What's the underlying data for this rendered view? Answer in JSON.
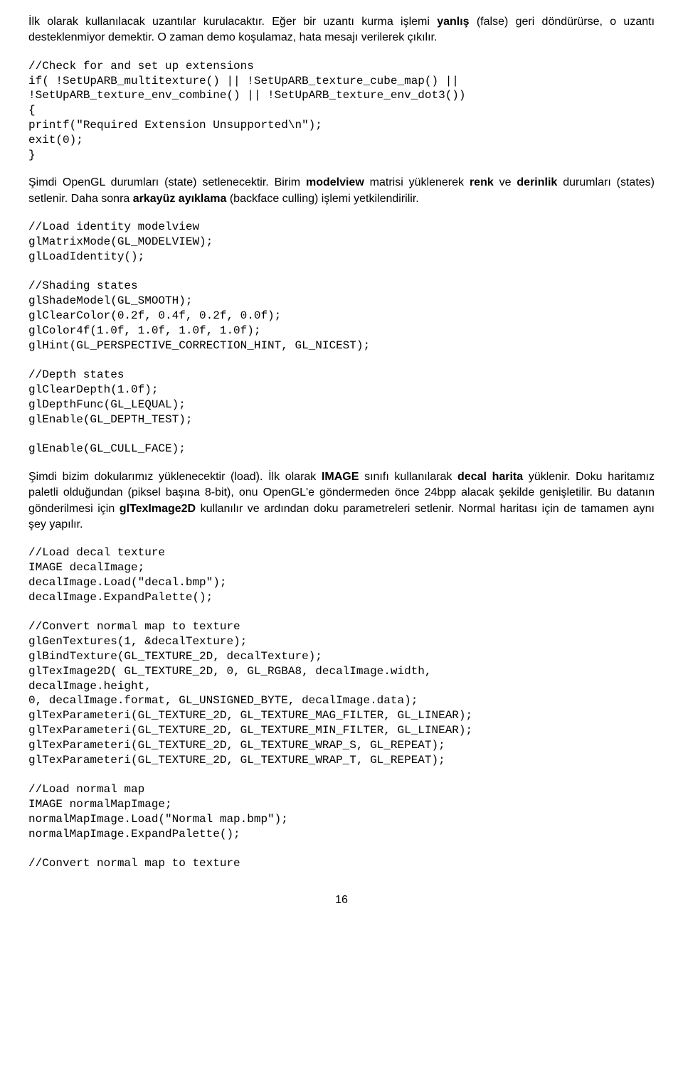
{
  "para1_a": "İlk olarak kullanılacak uzantılar kurulacaktır. Eğer bir uzantı  kurma işlemi ",
  "para1_b": "yanlış",
  "para1_c": " (false) geri döndürürse, o uzantı desteklenmiyor demektir. O zaman demo koşulamaz, hata mesajı verilerek çıkılır.",
  "code1": "//Check for and set up extensions\nif( !SetUpARB_multitexture() || !SetUpARB_texture_cube_map() ||\n!SetUpARB_texture_env_combine() || !SetUpARB_texture_env_dot3())\n{\nprintf(\"Required Extension Unsupported\\n\");\nexit(0);\n}",
  "para2_a": "Şimdi OpenGL durumları (state) setlenecektir. Birim ",
  "para2_b": "modelview",
  "para2_c": " matrisi yüklenerek ",
  "para2_d": "renk",
  "para2_e": " ve ",
  "para2_f": "derinlik",
  "para2_g": " durumları (states) setlenir. Daha sonra ",
  "para2_h": "arkayüz ayıklama",
  "para2_i": " (backface culling) işlemi yetkilendirilir.",
  "code2": "//Load identity modelview\nglMatrixMode(GL_MODELVIEW);\nglLoadIdentity();\n\n//Shading states\nglShadeModel(GL_SMOOTH);\nglClearColor(0.2f, 0.4f, 0.2f, 0.0f);\nglColor4f(1.0f, 1.0f, 1.0f, 1.0f);\nglHint(GL_PERSPECTIVE_CORRECTION_HINT, GL_NICEST);\n\n//Depth states\nglClearDepth(1.0f);\nglDepthFunc(GL_LEQUAL);\nglEnable(GL_DEPTH_TEST);\n\nglEnable(GL_CULL_FACE);",
  "para3_a": "Şimdi bizim dokularımız yüklenecektir (load). İlk olarak ",
  "para3_b": "IMAGE",
  "para3_c": " sınıfı kullanılarak ",
  "para3_d": "decal harita",
  "para3_e": " yüklenir. Doku haritamız paletli olduğundan (piksel başına 8-bit), onu OpenGL'e göndermeden önce 24bpp alacak şekilde genişletilir. Bu datanın gönderilmesi için ",
  "para3_f": "glTexImage2D",
  "para3_g": " kullanılır ve ardından doku parametreleri setlenir. Normal haritası için de tamamen aynı şey yapılır.",
  "code3": "//Load decal texture\nIMAGE decalImage;\ndecalImage.Load(\"decal.bmp\");\ndecalImage.ExpandPalette();\n\n//Convert normal map to texture\nglGenTextures(1, &decalTexture);\nglBindTexture(GL_TEXTURE_2D, decalTexture);\nglTexImage2D( GL_TEXTURE_2D, 0, GL_RGBA8, decalImage.width,\ndecalImage.height,\n0, decalImage.format, GL_UNSIGNED_BYTE, decalImage.data);\nglTexParameteri(GL_TEXTURE_2D, GL_TEXTURE_MAG_FILTER, GL_LINEAR);\nglTexParameteri(GL_TEXTURE_2D, GL_TEXTURE_MIN_FILTER, GL_LINEAR);\nglTexParameteri(GL_TEXTURE_2D, GL_TEXTURE_WRAP_S, GL_REPEAT);\nglTexParameteri(GL_TEXTURE_2D, GL_TEXTURE_WRAP_T, GL_REPEAT);\n\n//Load normal map\nIMAGE normalMapImage;\nnormalMapImage.Load(\"Normal map.bmp\");\nnormalMapImage.ExpandPalette();\n\n//Convert normal map to texture",
  "pagenum": "16"
}
